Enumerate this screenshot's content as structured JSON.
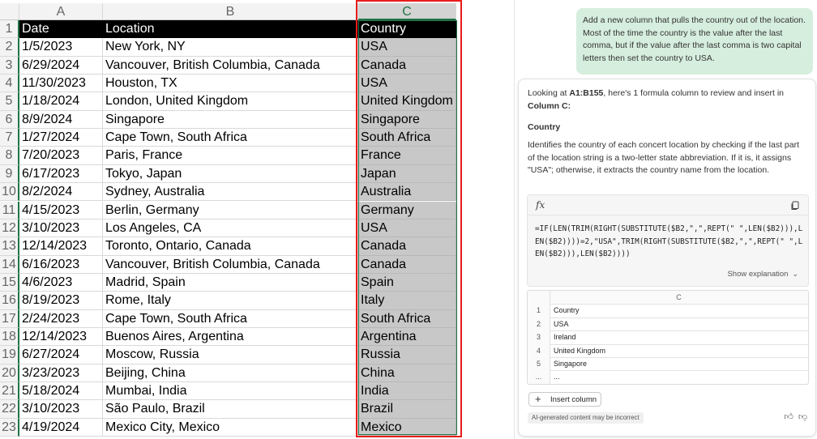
{
  "sheet": {
    "columns": [
      "A",
      "B",
      "C"
    ],
    "header_row": {
      "row": "1",
      "date": "Date",
      "location": "Location",
      "country": "Country"
    },
    "rows": [
      {
        "n": "2",
        "date": "1/5/2023",
        "location": "New York, NY",
        "country": "USA"
      },
      {
        "n": "3",
        "date": "6/29/2024",
        "location": "Vancouver, British Columbia, Canada",
        "country": "Canada"
      },
      {
        "n": "4",
        "date": "11/30/2023",
        "location": "Houston, TX",
        "country": "USA"
      },
      {
        "n": "5",
        "date": "1/18/2024",
        "location": "London, United Kingdom",
        "country": "United Kingdom"
      },
      {
        "n": "6",
        "date": "8/9/2024",
        "location": "Singapore",
        "country": "Singapore"
      },
      {
        "n": "7",
        "date": "1/27/2024",
        "location": "Cape Town, South Africa",
        "country": "South Africa"
      },
      {
        "n": "8",
        "date": "7/20/2023",
        "location": "Paris, France",
        "country": "France"
      },
      {
        "n": "9",
        "date": "6/17/2023",
        "location": "Tokyo, Japan",
        "country": "Japan"
      },
      {
        "n": "10",
        "date": "8/2/2024",
        "location": "Sydney, Australia",
        "country": "Australia"
      },
      {
        "n": "11",
        "date": "4/15/2023",
        "location": "Berlin, Germany",
        "country": "Germany"
      },
      {
        "n": "12",
        "date": "3/10/2023",
        "location": "Los Angeles, CA",
        "country": "USA"
      },
      {
        "n": "13",
        "date": "12/14/2023",
        "location": "Toronto, Ontario, Canada",
        "country": "Canada"
      },
      {
        "n": "14",
        "date": "6/16/2023",
        "location": "Vancouver, British Columbia, Canada",
        "country": "Canada"
      },
      {
        "n": "15",
        "date": "4/6/2023",
        "location": "Madrid, Spain",
        "country": "Spain"
      },
      {
        "n": "16",
        "date": "8/19/2023",
        "location": "Rome, Italy",
        "country": "Italy"
      },
      {
        "n": "17",
        "date": "2/24/2023",
        "location": "Cape Town, South Africa",
        "country": "South Africa"
      },
      {
        "n": "18",
        "date": "12/14/2023",
        "location": "Buenos Aires, Argentina",
        "country": "Argentina"
      },
      {
        "n": "19",
        "date": "6/27/2024",
        "location": "Moscow, Russia",
        "country": "Russia"
      },
      {
        "n": "20",
        "date": "3/23/2023",
        "location": "Beijing, China",
        "country": "China"
      },
      {
        "n": "21",
        "date": "5/18/2024",
        "location": "Mumbai, India",
        "country": "India"
      },
      {
        "n": "22",
        "date": "3/10/2023",
        "location": "São Paulo, Brazil",
        "country": "Brazil"
      },
      {
        "n": "23",
        "date": "4/19/2024",
        "location": "Mexico City, Mexico",
        "country": "Mexico"
      }
    ]
  },
  "chat": {
    "user_message": "Add a new column that pulls the country out of the location. Most of the time the country is the value after the last comma, but if the value after the last comma is two capital letters then set the country to USA.",
    "intro_prefix": "Looking at ",
    "intro_range": "A1:B155",
    "intro_middle": ", here's 1 formula column to review and insert in ",
    "intro_column": "Column C:",
    "column_title": "Country",
    "description": "Identifies the country of each concert location by checking if the last part of the location string is a two-letter state abbreviation. If it is, it assigns \"USA\"; otherwise, it extracts the country name from the location.",
    "fx_label": "fx",
    "formula": "=IF(LEN(TRIM(RIGHT(SUBSTITUTE($B2,\",\",REPT(\" \",LEN($B2))),LEN($B2))))=2,\"USA\",TRIM(RIGHT(SUBSTITUTE($B2,\",\",REPT(\" \",LEN($B2))),LEN($B2))))",
    "show_explanation": "Show explanation",
    "preview": {
      "column_letter": "C",
      "rows": [
        {
          "n": "1",
          "v": "Country"
        },
        {
          "n": "2",
          "v": "USA"
        },
        {
          "n": "3",
          "v": "Ireland"
        },
        {
          "n": "4",
          "v": "United Kingdom"
        },
        {
          "n": "5",
          "v": "Singapore"
        },
        {
          "n": "...",
          "v": "..."
        }
      ]
    },
    "insert_label": "Insert column",
    "ai_note": "AI-generated content may be incorrect"
  },
  "icons": {
    "copy": "copy-icon",
    "thumbs_up": "thumbs-up-icon",
    "thumbs_down": "thumbs-down-icon",
    "plus": "plus-icon",
    "chevron": "chevron-down-icon"
  },
  "colors": {
    "selection_green": "#217346",
    "highlight_red": "#e81c1c",
    "chat_bubble": "#d6eedd",
    "selected_column_fill": "#c8c8c8"
  }
}
